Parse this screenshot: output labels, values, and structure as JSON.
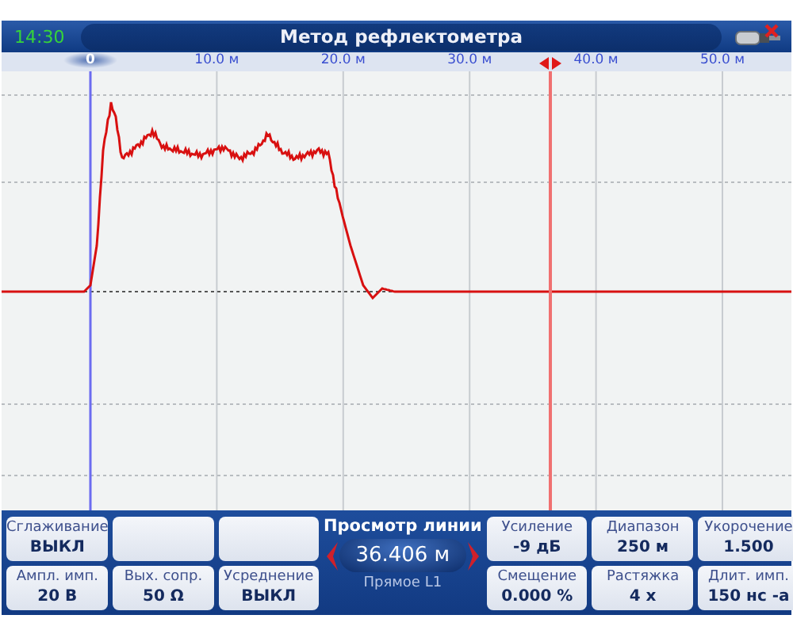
{
  "header": {
    "time": "14:30",
    "title": "Метод рефлектометра"
  },
  "ruler": {
    "labels": [
      "0",
      "10.0 м",
      "20.0 м",
      "30.0 м",
      "40.0 м",
      "50.0 м"
    ]
  },
  "panel": {
    "left_tiles": [
      {
        "kind": "setting",
        "label": "Сглаживание",
        "value": "ВЫКЛ"
      },
      {
        "kind": "blank"
      },
      {
        "kind": "blank"
      },
      {
        "kind": "setting",
        "label": "Ампл. имп.",
        "value": "20 В"
      },
      {
        "kind": "setting",
        "label": "Вых. сопр.",
        "value": "50 Ω"
      },
      {
        "kind": "setting",
        "label": "Усреднение",
        "value": "ВЫКЛ"
      }
    ],
    "center": {
      "title": "Просмотр линии",
      "value": "36.406 м",
      "mode": "Прямое L1"
    },
    "right_tiles": [
      {
        "kind": "setting",
        "label": "Усиление",
        "value": "-9 дБ"
      },
      {
        "kind": "setting",
        "label": "Диапазон",
        "value": "250 м"
      },
      {
        "kind": "setting",
        "label": "Укорочение",
        "value": "1.500"
      },
      {
        "kind": "setting",
        "label": "Смещение",
        "value": "0.000 %"
      },
      {
        "kind": "setting",
        "label": "Растяжка",
        "value": "4 x"
      },
      {
        "kind": "setting",
        "label": "Длит. имп.",
        "value": "150 нс -а"
      }
    ]
  }
}
